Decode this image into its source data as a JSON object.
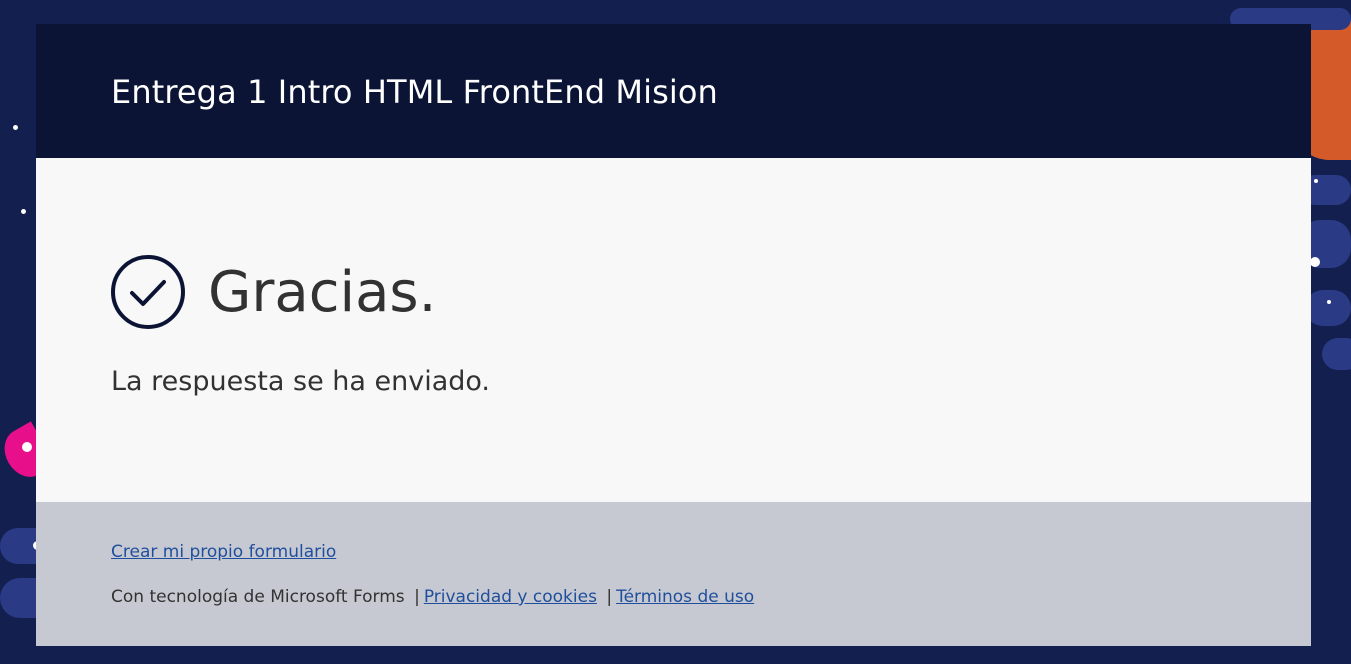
{
  "header": {
    "form_title": "Entrega 1 Intro HTML FrontEnd Mision"
  },
  "confirmation": {
    "icon": "check-circle-icon",
    "heading": "Gracias.",
    "message": "La respuesta se ha enviado."
  },
  "footer": {
    "create_form_link": "Crear mi propio formulario",
    "powered_by": "Con tecnología de Microsoft Forms",
    "separator": "|",
    "privacy_link": "Privacidad y cookies",
    "terms_link": "Términos de uso"
  },
  "colors": {
    "page_background": "#13204f",
    "header_background": "#0b1434",
    "body_background": "#f8f8f8",
    "footer_background": "#c7c9d2",
    "link": "#1f4f9c",
    "accent_orange": "#d45a29",
    "accent_pink": "#e8108a"
  }
}
